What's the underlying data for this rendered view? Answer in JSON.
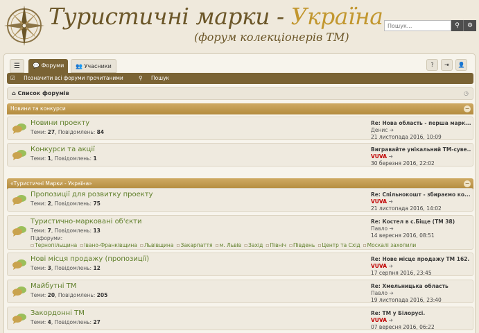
{
  "header": {
    "title_main": "Туристичні марки - ",
    "title_accent": "Україна",
    "subtitle": "(форум колекціонерів ТМ)",
    "search_placeholder": "Пошук..."
  },
  "tabs": {
    "forums": "Форуми",
    "members": "Учасники"
  },
  "navbar": {
    "mark_read": "Позначити всі форуми прочитаними",
    "search": "Пошук"
  },
  "breadcrumb": "Список форумів",
  "categories": [
    {
      "title": "Новини та конкурси",
      "forums": [
        {
          "name": "Новини проекту",
          "topics_label": "Теми:",
          "topics": "27",
          "posts_label": "Повідомлень:",
          "posts": "84",
          "last_title": "Re: Нова область - перша марк...",
          "last_author": "Денис",
          "last_author_red": false,
          "last_date": "21 листопада 2016, 10:09"
        },
        {
          "name": "Конкурси та акції",
          "topics_label": "Теми:",
          "topics": "1",
          "posts_label": "Повідомлень:",
          "posts": "1",
          "last_title": "Вигравайте унікальний ТМ-суве...",
          "last_author": "VUVA",
          "last_author_red": true,
          "last_date": "30 березня 2016, 22:02"
        }
      ]
    },
    {
      "title": "«Туристичні Марки - Україна»",
      "forums": [
        {
          "name": "Пропозиції для розвитку проекту",
          "topics_label": "Теми:",
          "topics": "2",
          "posts_label": "Повідомлень:",
          "posts": "75",
          "last_title": "Re: Спільнокошт - збираємо ко...",
          "last_author": "VUVA",
          "last_author_red": true,
          "last_date": "21 листопада 2016, 14:02"
        },
        {
          "name": "Туристично-марковані об'єкти",
          "topics_label": "Теми:",
          "topics": "7",
          "posts_label": "Повідомлень:",
          "posts": "13",
          "subforums_label": "Підфоруми:",
          "subforums": [
            "Тернопільщина",
            "Івано-Франківщина",
            "Львівщина",
            "Закарпаття",
            "м. Львів",
            "Захід",
            "Північ",
            "Південь",
            "Центр та Схід",
            "Москалі захопили"
          ],
          "last_title": "Re: Костел в с.Біще (ТМ 38)",
          "last_author": "Павло",
          "last_author_red": false,
          "last_date": "14 вересня 2016, 08:51"
        },
        {
          "name": "Нові місця продажу (пропозиції)",
          "topics_label": "Теми:",
          "topics": "3",
          "posts_label": "Повідомлень:",
          "posts": "12",
          "last_title": "Re: Нове місце продажу ТМ 162.",
          "last_author": "VUVA",
          "last_author_red": true,
          "last_date": "17 серпня 2016, 23:45"
        },
        {
          "name": "Майбутні ТМ",
          "topics_label": "Теми:",
          "topics": "20",
          "posts_label": "Повідомлень:",
          "posts": "205",
          "last_title": "Re: Хмельницька область",
          "last_author": "Павло",
          "last_author_red": false,
          "last_date": "19 листопада 2016, 23:40"
        },
        {
          "name": "Закордонні ТМ",
          "topics_label": "Теми:",
          "topics": "4",
          "posts_label": "Повідомлень:",
          "posts": "27",
          "last_title": "Re: ТМ у Білорусі.",
          "last_author": "VUVA",
          "last_author_red": true,
          "last_date": "07 вересня 2016, 06:22"
        }
      ]
    }
  ],
  "colors": {
    "brand_brown": "#7a6334",
    "category_gold": "#c2972f",
    "forum_green": "#5f7f2a",
    "author_red": "#c00000"
  }
}
